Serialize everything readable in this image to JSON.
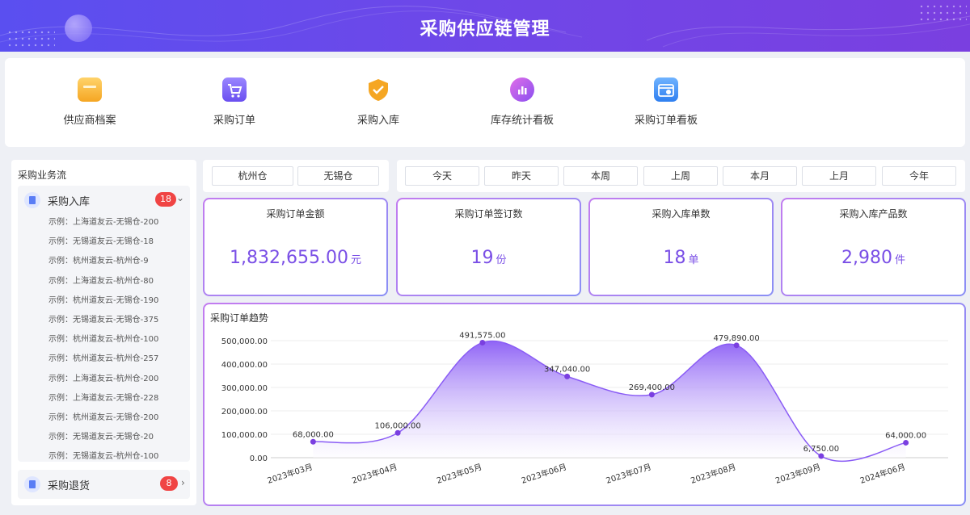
{
  "header": {
    "title": "采购供应链管理"
  },
  "quick_nav": [
    {
      "label": "供应商档案",
      "icon": "supplier-box-icon",
      "color": "#f7b731"
    },
    {
      "label": "采购订单",
      "icon": "cart-icon",
      "color": "#7a5cf0"
    },
    {
      "label": "采购入库",
      "icon": "shield-check-icon",
      "color": "#f5a623"
    },
    {
      "label": "库存统计看板",
      "icon": "chart-circle-icon",
      "color": "#b455e6"
    },
    {
      "label": "采购订单看板",
      "icon": "calendar-board-icon",
      "color": "#3b8cf5"
    }
  ],
  "left_panel": {
    "title": "采购业务流",
    "groups": [
      {
        "label": "采购入库",
        "badge": "18",
        "expanded": true,
        "items": [
          "示例：上海道友云-无锡仓-200",
          "示例：无锡道友云-无锡仓-18",
          "示例：杭州道友云-杭州仓-9",
          "示例：上海道友云-杭州仓-80",
          "示例：杭州道友云-无锡仓-190",
          "示例：无锡道友云-无锡仓-375",
          "示例：杭州道友云-杭州仓-100",
          "示例：杭州道友云-杭州仓-257",
          "示例：上海道友云-杭州仓-200",
          "示例：上海道友云-无锡仓-228",
          "示例：杭州道友云-无锡仓-200",
          "示例：无锡道友云-无锡仓-20",
          "示例：无锡道友云-杭州仓-100"
        ]
      },
      {
        "label": "采购退货",
        "badge": "8",
        "expanded": false
      }
    ]
  },
  "warehouses": [
    "杭州仓",
    "无锡仓"
  ],
  "date_filters": [
    "今天",
    "昨天",
    "本周",
    "上周",
    "本月",
    "上月",
    "今年"
  ],
  "kpis": [
    {
      "title": "采购订单金额",
      "value": "1,832,655.00",
      "unit": "元"
    },
    {
      "title": "采购订单签订数",
      "value": "19",
      "unit": "份"
    },
    {
      "title": "采购入库单数",
      "value": "18",
      "unit": "单"
    },
    {
      "title": "采购入库产品数",
      "value": "2,980",
      "unit": "件"
    }
  ],
  "chart": {
    "title": "采购订单趋势"
  },
  "chart_data": {
    "type": "area",
    "title": "采购订单趋势",
    "categories": [
      "2023年03月",
      "2023年04月",
      "2023年05月",
      "2023年06月",
      "2023年07月",
      "2023年08月",
      "2023年09月",
      "2024年06月"
    ],
    "values": [
      68000,
      106000,
      491575,
      347040,
      269400,
      479890,
      6750,
      64000
    ],
    "data_labels": [
      "68,000.00",
      "106,000.00",
      "491,575.00",
      "347,040.00",
      "269,400.00",
      "479,890.00",
      "6,750.00",
      "64,000.00"
    ],
    "ylim": [
      0,
      500000
    ],
    "yticks": [
      0,
      100000,
      200000,
      300000,
      400000,
      500000
    ],
    "ytick_labels": [
      "0.00",
      "100,000.00",
      "200,000.00",
      "300,000.00",
      "400,000.00",
      "500,000.00"
    ],
    "grid": true,
    "line_color": "#8a5cf5"
  }
}
